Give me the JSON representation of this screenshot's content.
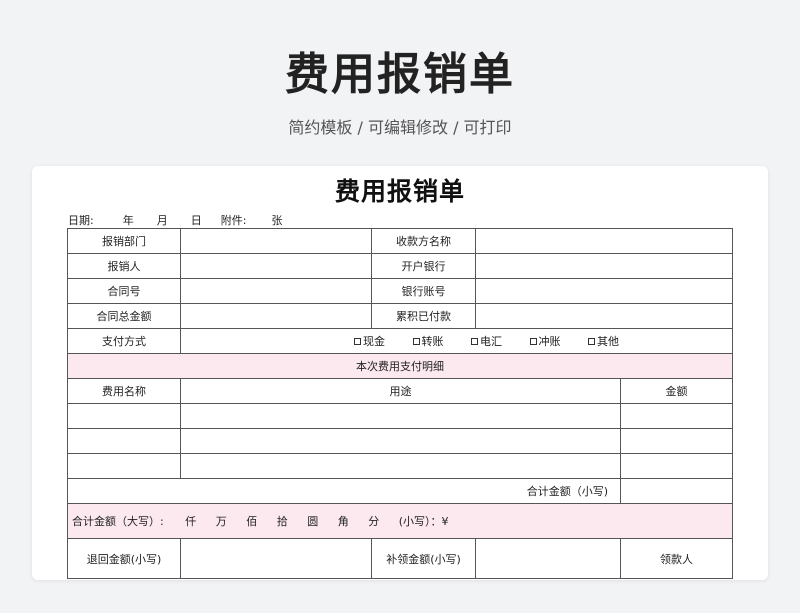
{
  "header": {
    "title": "费用报销单",
    "subtitle": "简约模板 /  可编辑修改  / 可打印"
  },
  "form": {
    "title": "费用报销单",
    "date_line": {
      "date_label": "日期:",
      "year": "年",
      "month": "月",
      "day": "日",
      "attachments_label": "附件:",
      "sheets": "张"
    },
    "rows": {
      "department": "报销部门",
      "payee_name": "收款方名称",
      "claimant": "报销人",
      "bank": "开户银行",
      "contract_no": "合同号",
      "account_no": "银行账号",
      "contract_total": "合同总金额",
      "paid_total": "累积已付款",
      "payment_method": "支付方式"
    },
    "payment_options": [
      "现金",
      "转账",
      "电汇",
      "冲账",
      "其他"
    ],
    "detail_title": "本次费用支付明细",
    "detail_headers": {
      "name": "费用名称",
      "purpose": "用途",
      "amount": "金额"
    },
    "subtotal_label": "合计金额（小写)",
    "uppercase_total": {
      "label": "合计金额（大写）:",
      "units": [
        "仟",
        "万",
        "佰",
        "拾",
        "圆",
        "角",
        "分"
      ],
      "lowercase_label": "(小写）：¥"
    },
    "footer": {
      "refund": "退回金额(小写)",
      "supplement": "补领金额(小写)",
      "recipient": "领款人"
    }
  }
}
